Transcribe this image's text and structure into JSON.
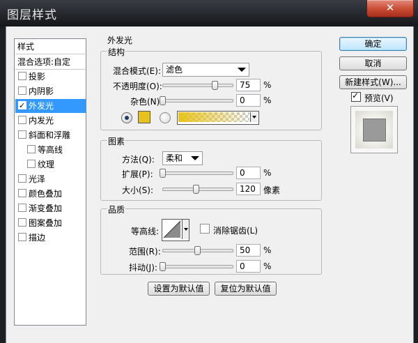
{
  "window": {
    "title": "图层样式",
    "close_glyph": "✕"
  },
  "styles_list": {
    "header": "样式",
    "blend_options": "混合选项:自定",
    "items": [
      {
        "label": "投影",
        "checked": false
      },
      {
        "label": "内阴影",
        "checked": false
      },
      {
        "label": "外发光",
        "checked": true,
        "selected": true
      },
      {
        "label": "内发光",
        "checked": false
      },
      {
        "label": "斜面和浮雕",
        "checked": false
      },
      {
        "label": "等高线",
        "checked": false,
        "indent": true
      },
      {
        "label": "纹理",
        "checked": false,
        "indent": true
      },
      {
        "label": "光泽",
        "checked": false
      },
      {
        "label": "颜色叠加",
        "checked": false
      },
      {
        "label": "渐变叠加",
        "checked": false
      },
      {
        "label": "图案叠加",
        "checked": false
      },
      {
        "label": "描边",
        "checked": false
      }
    ]
  },
  "outer_glow": {
    "title": "外发光",
    "structure": {
      "title": "结构",
      "blend_mode_label": "混合模式(E):",
      "blend_mode_value": "滤色",
      "opacity_label": "不透明度(O):",
      "opacity_value": "75",
      "opacity_unit": "%",
      "opacity_fraction": 0.75,
      "noise_label": "杂色(N):",
      "noise_value": "0",
      "noise_unit": "%",
      "noise_fraction": 0.0,
      "glow_color": "#e8c21c"
    },
    "elements": {
      "title": "图素",
      "technique_label": "方法(Q):",
      "technique_value": "柔和",
      "spread_label": "扩展(P):",
      "spread_value": "0",
      "spread_unit": "%",
      "spread_fraction": 0.0,
      "size_label": "大小(S):",
      "size_value": "120",
      "size_unit": "像素",
      "size_fraction": 0.48
    },
    "quality": {
      "title": "品质",
      "contour_label": "等高线:",
      "antialias_label": "消除锯齿(L)",
      "antialias_checked": false,
      "range_label": "范围(R):",
      "range_value": "50",
      "range_unit": "%",
      "range_fraction": 0.5,
      "jitter_label": "抖动(J):",
      "jitter_value": "0",
      "jitter_unit": "%",
      "jitter_fraction": 0.0
    },
    "set_default": "设置为默认值",
    "reset_default": "复位为默认值"
  },
  "buttons": {
    "ok": "确定",
    "cancel": "取消",
    "new_style": "新建样式(W)...",
    "preview_label": "预览(V)",
    "preview_checked": true
  }
}
